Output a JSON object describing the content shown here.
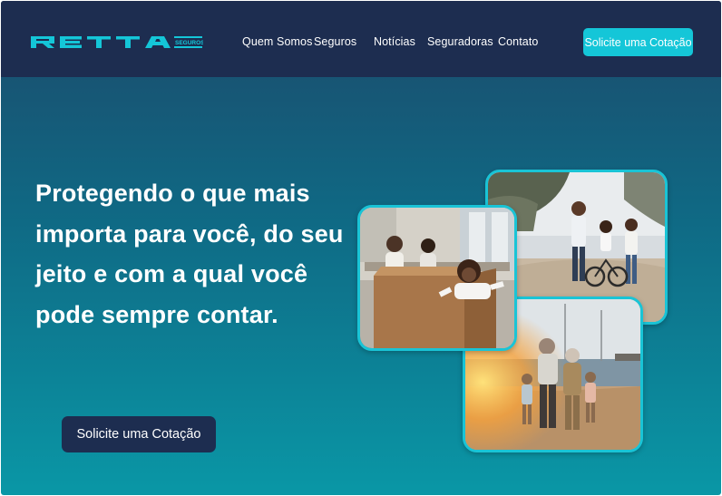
{
  "brand": {
    "name": "RETTA",
    "tagline": "SEGUROS",
    "accent_color": "#14c6d8",
    "navy_color": "#1d2d50"
  },
  "nav": {
    "links": [
      "Quem Somos",
      "Seguros",
      "Notícias",
      "Seguradoras",
      "Contato"
    ],
    "cta_label": "Solicite uma Cotação"
  },
  "hero": {
    "headline": "Protegendo o que mais importa para você, do seu jeito e com a qual você pode sempre contar.",
    "cta_label": "Solicite uma Cotação"
  },
  "photos": [
    {
      "name": "family-park-photo",
      "subject": "family walking and child riding bicycle in park"
    },
    {
      "name": "family-moving-photo",
      "subject": "family unpacking moving boxes at home"
    },
    {
      "name": "grandparents-beach-photo",
      "subject": "grandparents with grandchildren on beach at sunset"
    }
  ]
}
